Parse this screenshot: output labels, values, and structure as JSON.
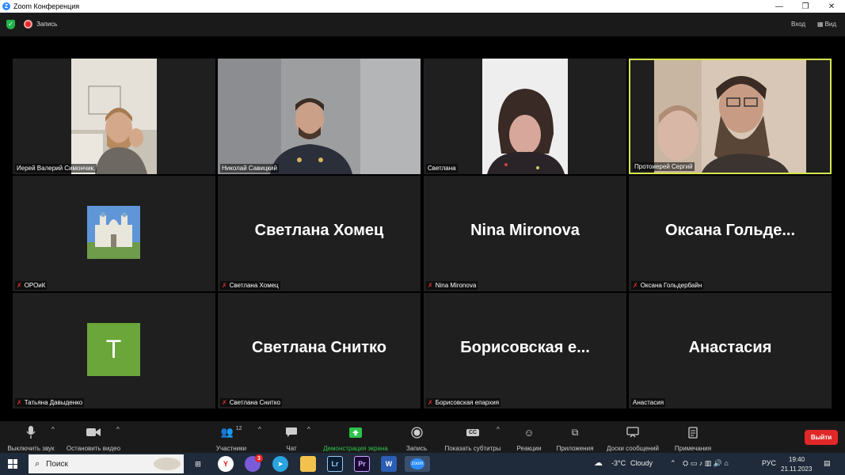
{
  "window": {
    "title": "Zoom Конференция",
    "logo_letter": "Z",
    "controls": {
      "minimize": "—",
      "restore": "❐",
      "close": "✕"
    }
  },
  "topbar": {
    "recording_label": "Запись",
    "exit_fullscreen_label": "Вход",
    "view_label": "Вид"
  },
  "participants": [
    {
      "name": "Иерей Валерий Симончик.",
      "type": "video",
      "muted": false
    },
    {
      "name": "Николай Савицкий",
      "type": "video",
      "muted": false
    },
    {
      "name": "Светлана",
      "type": "video",
      "muted": false
    },
    {
      "name": "Протоиерей Сергий",
      "type": "video",
      "muted": false,
      "active_speaker": true
    },
    {
      "name": "ОРОиК",
      "type": "picture",
      "muted": true
    },
    {
      "name": "Светлана Хомец",
      "display": "Светлана Хомец",
      "type": "name",
      "muted": true
    },
    {
      "name": "Nina Mironova",
      "display": "Nina Mironova",
      "type": "name",
      "muted": true
    },
    {
      "name": "Оксана Гольдербайн",
      "display": "Оксана  Гольде...",
      "type": "name",
      "muted": true
    },
    {
      "name": "Татьяна Давыденко",
      "avatar_letter": "T",
      "type": "avatar",
      "muted": true
    },
    {
      "name": "Светлана Снитко",
      "display": "Светлана Снитко",
      "type": "name",
      "muted": true
    },
    {
      "name": "Борисовская епархия",
      "display": "Борисовская  е...",
      "type": "name",
      "muted": true
    },
    {
      "name": "Анастасия",
      "display": "Анастасия",
      "type": "name",
      "muted": false
    }
  ],
  "toolbar": {
    "mute": "Выключить звук",
    "video": "Остановить видео",
    "participants": "Участники",
    "participants_count": "12",
    "chat": "Чат",
    "share": "Демонстрация экрана",
    "record": "Запись",
    "captions": "Показать субтитры",
    "captions_icon_text": "CC",
    "reactions": "Реакции",
    "apps": "Приложения",
    "whiteboards": "Доски сообщений",
    "notes": "Примечания",
    "leave": "Выйти"
  },
  "taskbar": {
    "search_placeholder": "Поиск",
    "weather_temp": "-3°C",
    "weather_text": "Cloudy",
    "language": "РУС",
    "time": "19:40",
    "date": "21.11.2023",
    "apps": {
      "yandex": "Y",
      "lightroom": "Lr",
      "premiere": "Pr",
      "word": "W",
      "zoom": "zoom"
    },
    "viber_badge": "3"
  },
  "colors": {
    "active_border": "#d6e64a",
    "leave_red": "#e02828",
    "share_green": "#2ec24a",
    "mute_red": "#e03030",
    "avatar_green": "#6aa63a"
  }
}
